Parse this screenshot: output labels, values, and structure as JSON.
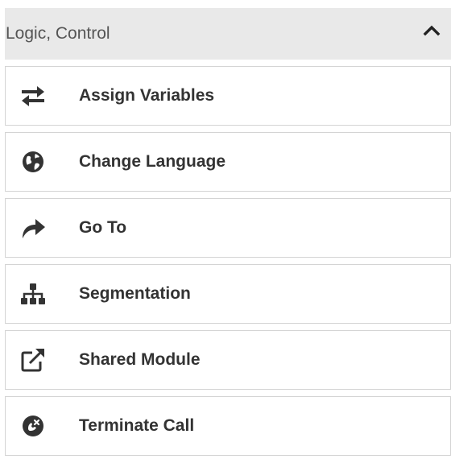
{
  "panel": {
    "title": "Logic, Control",
    "collapse_icon": "chevron-up-icon",
    "items": [
      {
        "label": "Assign Variables",
        "icon": "swap-arrows-icon"
      },
      {
        "label": "Change Language",
        "icon": "globe-icon"
      },
      {
        "label": "Go To",
        "icon": "share-arrow-icon"
      },
      {
        "label": "Segmentation",
        "icon": "sitemap-icon"
      },
      {
        "label": "Shared Module",
        "icon": "external-link-icon"
      },
      {
        "label": "Terminate Call",
        "icon": "hangup-call-icon"
      }
    ]
  },
  "colors": {
    "header_bg": "#e9e9e9",
    "icon": "#333333",
    "border": "#d4d4d4"
  }
}
